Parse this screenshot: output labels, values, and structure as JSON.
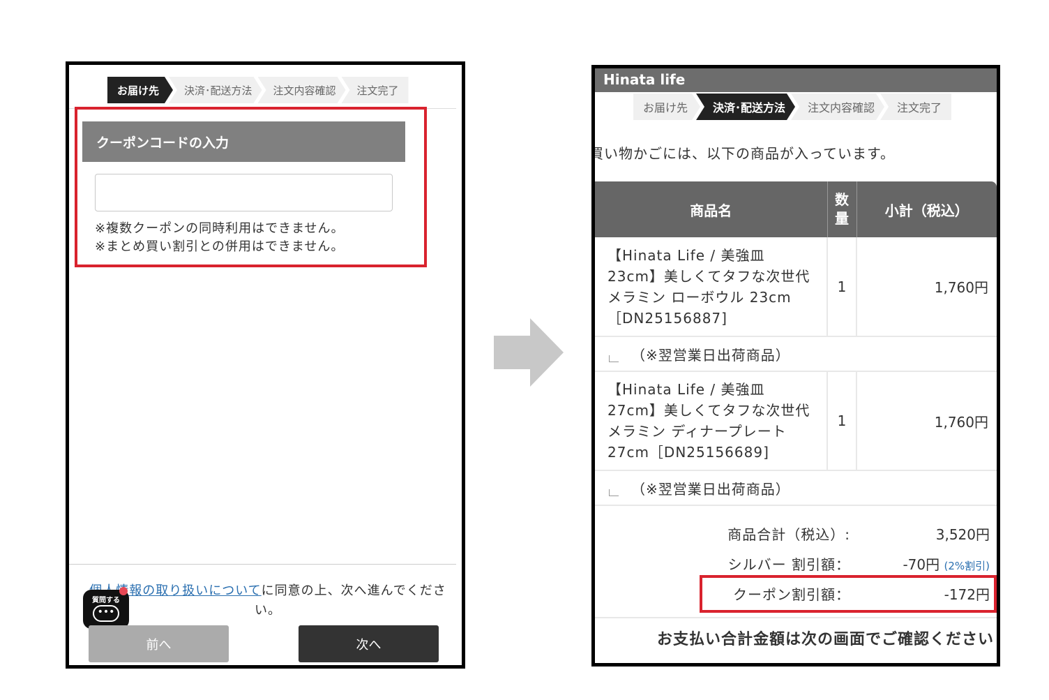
{
  "left": {
    "steps": [
      "お届け先",
      "決済･配送方法",
      "注文内容確認",
      "注文完了"
    ],
    "coupon": {
      "header": "クーポンコードの入力",
      "input_value": "",
      "note1": "※複数クーポンの同時利用はできません。",
      "note2": "※まとめ買い割引との併用はできません。"
    },
    "agree": {
      "link": "個人情報の取り扱いについて",
      "text": "に同意の上、次へ進んでください。"
    },
    "chat": {
      "label": "質問する",
      "icon": "chat-bubble-icon"
    },
    "prev_button": "前へ",
    "next_button": "次へ"
  },
  "right": {
    "title": "Hinata life",
    "steps": [
      "お届け先",
      "決済･配送方法",
      "注文内容確認",
      "注文完了"
    ],
    "cart_intro": "買い物かごには、以下の商品が入っています。",
    "table": {
      "headers": {
        "name": "商品名",
        "qty_line1": "数",
        "qty_line2": "量",
        "subtotal": "小計（税込）"
      },
      "rows": [
        {
          "name": "【Hinata Life / 美強皿 23cm】美しくてタフな次世代メラミン ローボウル 23cm［DN25156887]",
          "qty": "1",
          "subtotal": "1,760円",
          "note": "（※翌営業日出荷商品）"
        },
        {
          "name": "【Hinata Life / 美強皿 27cm】美しくてタフな次世代メラミン ディナープレート 27cm［DN25156689]",
          "qty": "1",
          "subtotal": "1,760円",
          "note": "（※翌営業日出荷商品）"
        }
      ]
    },
    "totals": {
      "goods_label": "商品合計（税込）:",
      "goods_value": "3,520円",
      "silver_label": "シルバー 割引額：",
      "silver_value": "-70円",
      "silver_note": "(2%割引)",
      "coupon_label": "クーポン割引額：",
      "coupon_value": "-172円"
    },
    "pay_note": "お支払い合計金額は次の画面でご確認ください"
  },
  "colors": {
    "highlight_red": "#d9232e",
    "header_gray": "#808080",
    "step_active": "#222222",
    "link_blue": "#2a6fb0"
  }
}
